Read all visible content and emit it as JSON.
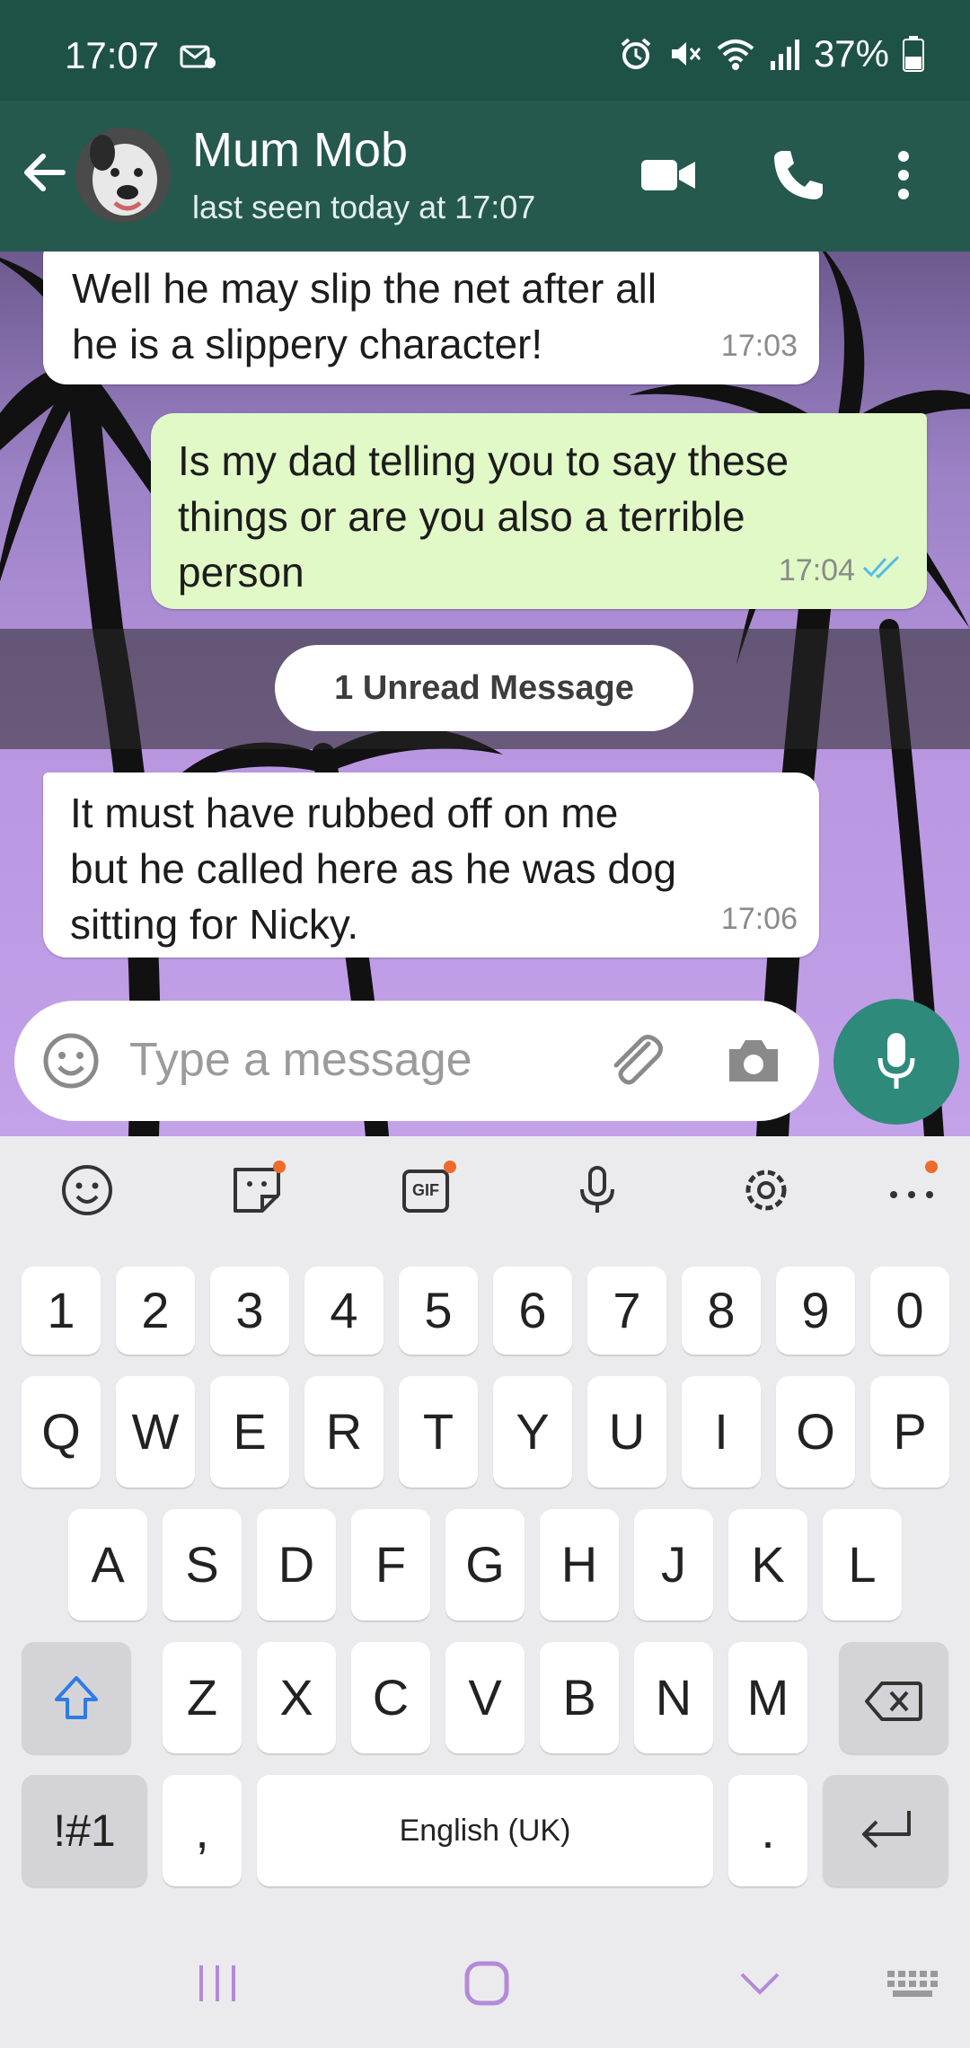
{
  "status_bar": {
    "time": "17:07",
    "battery": "37%"
  },
  "header": {
    "title": "Mum Mob",
    "subtitle": "last seen today at 17:07"
  },
  "messages": [
    {
      "dir": "in",
      "text": "Well he may slip the net after all\nhe is a slippery character!",
      "time": "17:03"
    },
    {
      "dir": "out",
      "text": "Is my dad telling you to say these\nthings or are you also a terrible\nperson",
      "time": "17:04"
    },
    {
      "dir": "in",
      "text": "It must have rubbed off on me\nbut he called here as he was dog\nsitting for Nicky.",
      "time": "17:06"
    }
  ],
  "unread_banner": "1 Unread Message",
  "composer": {
    "placeholder": "Type a message"
  },
  "keyboard": {
    "number_row": [
      "1",
      "2",
      "3",
      "4",
      "5",
      "6",
      "7",
      "8",
      "9",
      "0"
    ],
    "row1": [
      "Q",
      "W",
      "E",
      "R",
      "T",
      "Y",
      "U",
      "I",
      "O",
      "P"
    ],
    "row2": [
      "A",
      "S",
      "D",
      "F",
      "G",
      "H",
      "J",
      "K",
      "L"
    ],
    "row3": [
      "Z",
      "X",
      "C",
      "V",
      "B",
      "N",
      "M"
    ],
    "symbols_key": "!#1",
    "comma_key": ",",
    "space_key": "English (UK)",
    "period_key": ".",
    "gif_label": "GIF"
  },
  "colors": {
    "header": "#25594e",
    "status_bar": "#1f5247",
    "accent": "#2e8a7b",
    "outgoing_bubble": "#e1f8c7",
    "read_ticks": "#53bdeb"
  }
}
